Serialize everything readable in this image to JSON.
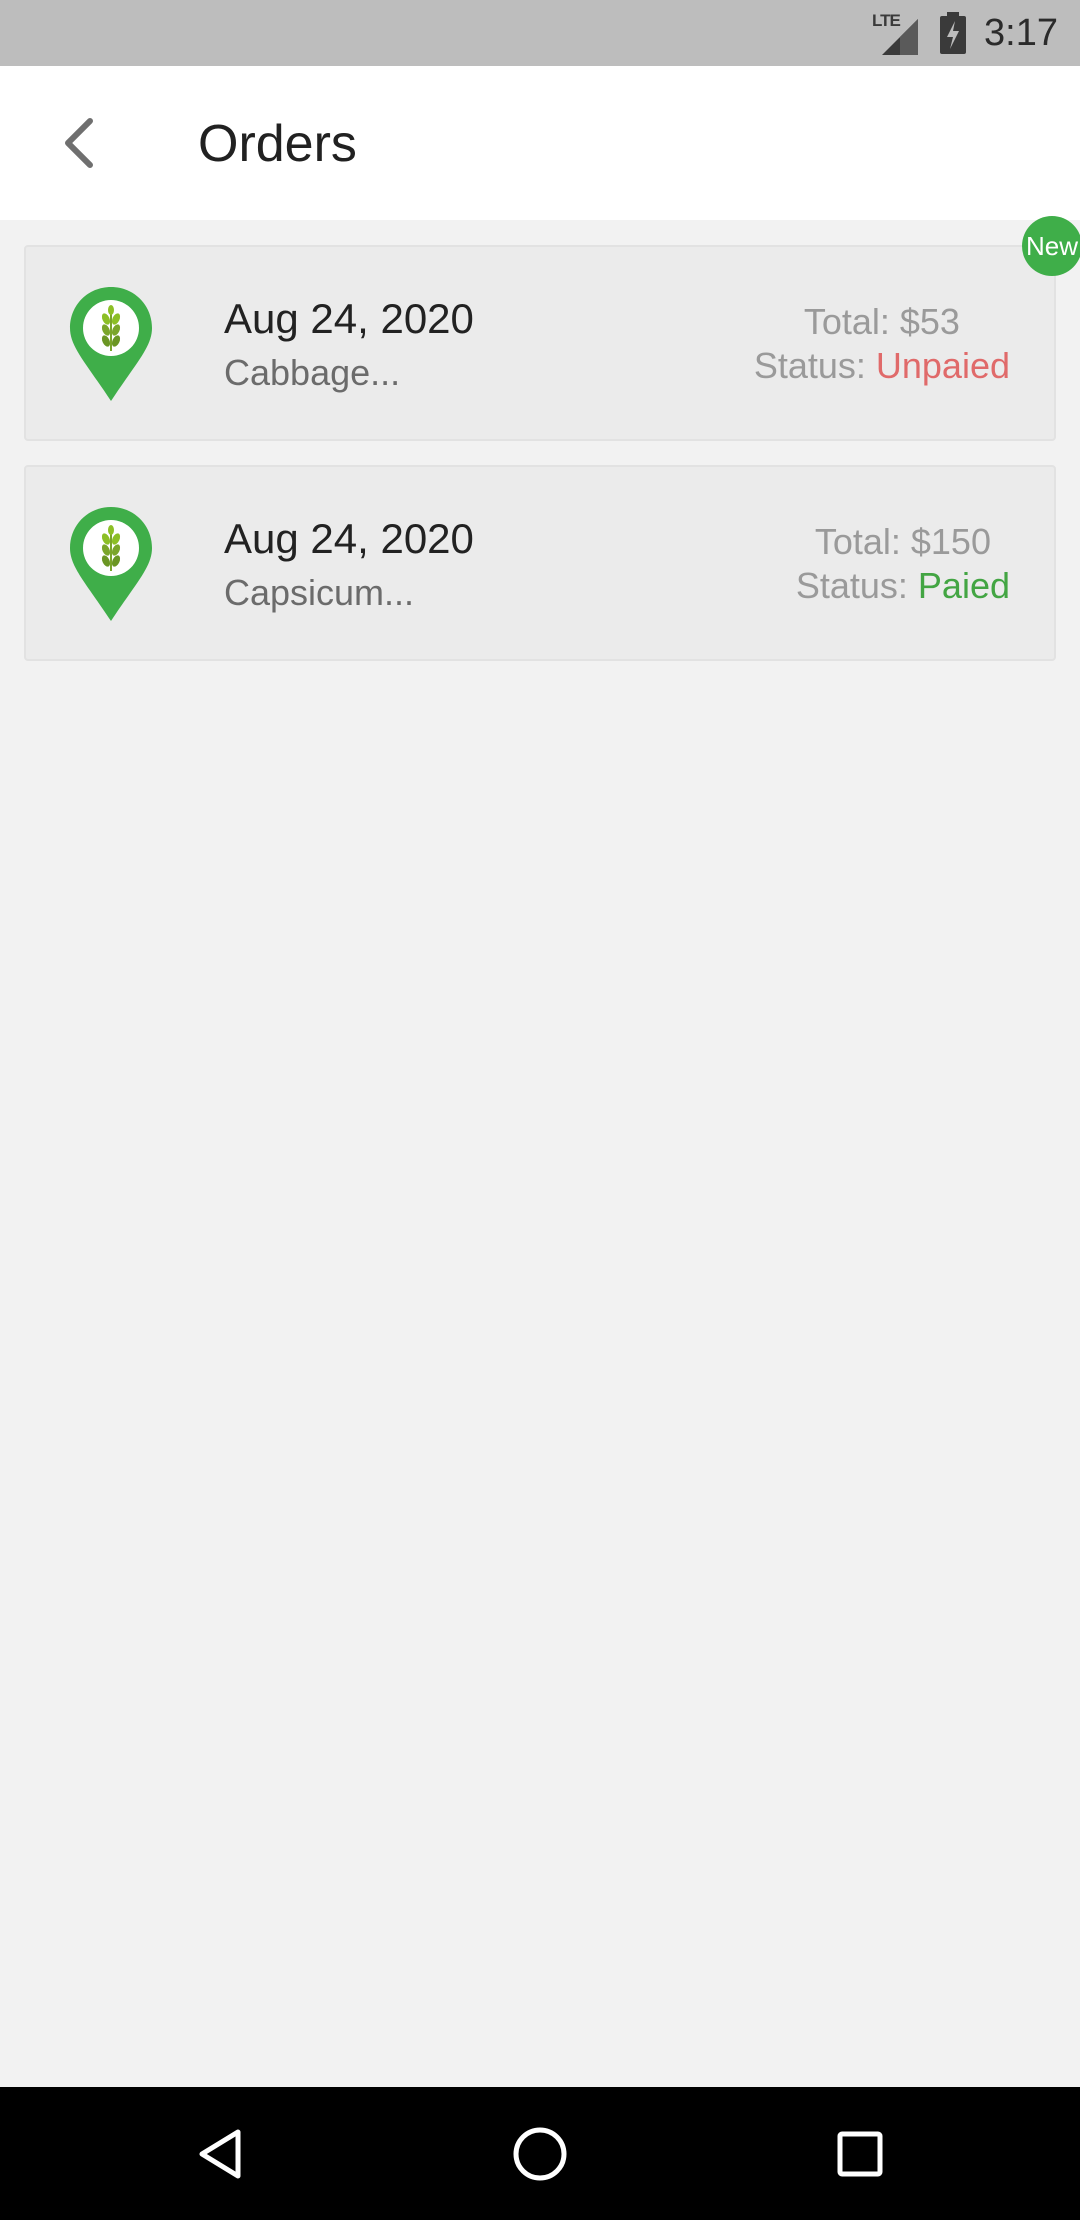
{
  "status_bar": {
    "network": "LTE",
    "time": "3:17"
  },
  "header": {
    "title": "Orders"
  },
  "orders": [
    {
      "date": "Aug 24, 2020",
      "items": "Cabbage...",
      "total": "Total: $53",
      "status_label": "Status:",
      "status_value": "Unpaied",
      "badge": "New"
    },
    {
      "date": "Aug 24, 2020",
      "items": "Capsicum...",
      "total": "Total: $150",
      "status_label": "Status:",
      "status_value": "Paied"
    }
  ],
  "icons": {
    "back": "chevron-left-icon",
    "order": "location-pin-leaf-icon",
    "nav_back": "triangle-back-icon",
    "nav_home": "circle-home-icon",
    "nav_recent": "square-recents-icon"
  },
  "colors": {
    "accent_green": "#3fae49",
    "unpaid_red": "#e06a6a",
    "paid_green": "#43a543"
  }
}
